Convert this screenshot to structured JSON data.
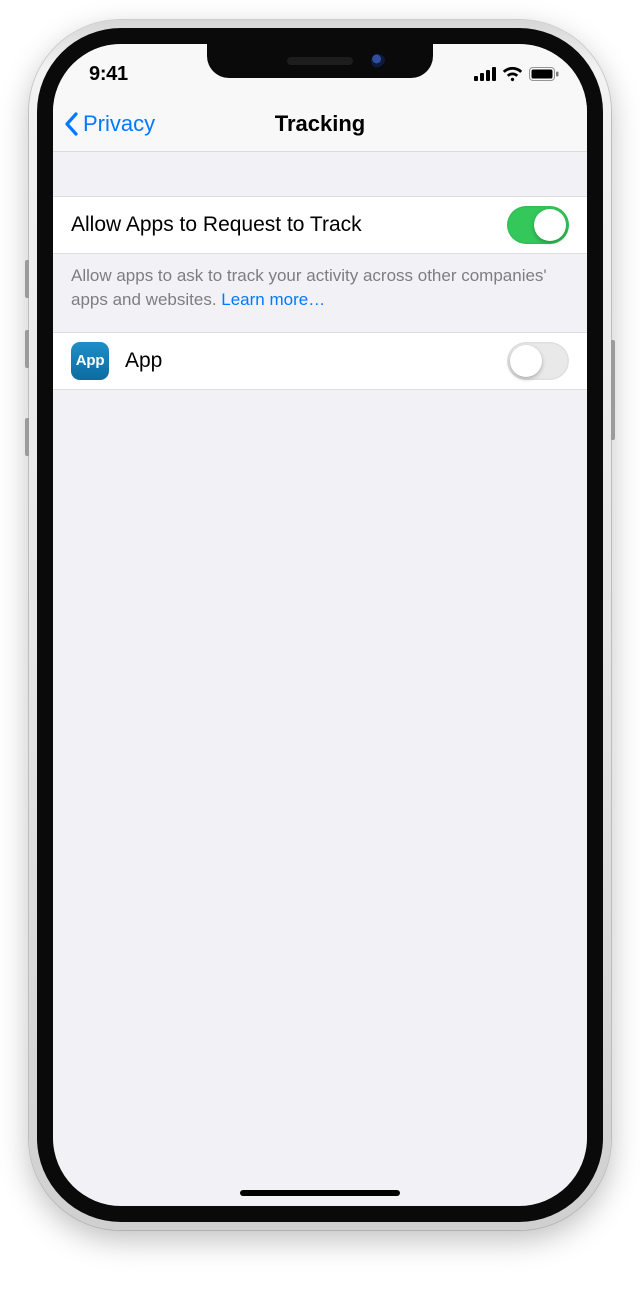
{
  "status": {
    "time": "9:41"
  },
  "nav": {
    "back_label": "Privacy",
    "title": "Tracking"
  },
  "allow": {
    "label": "Allow Apps to Request to Track",
    "enabled": true,
    "footer_text": "Allow apps to ask to track your activity across other companies' apps and websites. ",
    "learn_more": "Learn more…"
  },
  "app_row": {
    "icon_text": "App",
    "name": "App",
    "enabled": false
  },
  "colors": {
    "link": "#007aff",
    "switch_on": "#34c759",
    "bg": "#f2f1f6"
  }
}
